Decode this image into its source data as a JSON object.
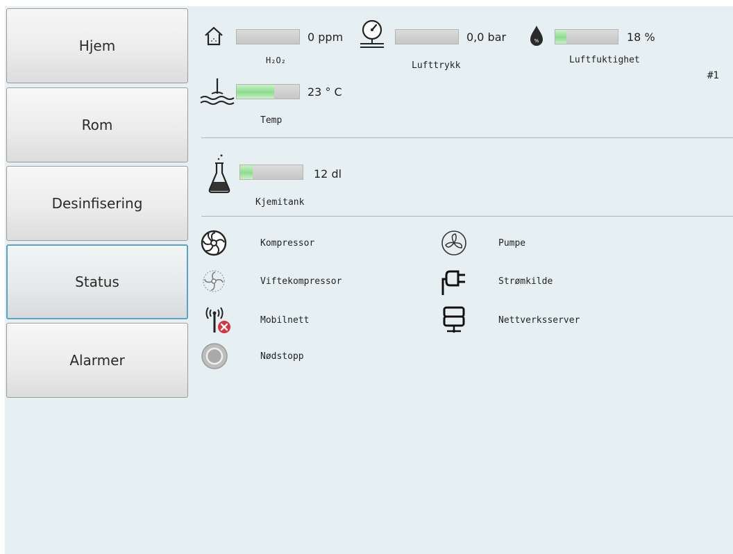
{
  "nav": {
    "items": [
      {
        "label": "Hjem"
      },
      {
        "label": "Rom"
      },
      {
        "label": "Desinfisering"
      },
      {
        "label": "Status"
      },
      {
        "label": "Alarmer"
      }
    ],
    "active": "Status"
  },
  "unit_id": "#1",
  "sensors": {
    "h2o2": {
      "value": "0 ppm",
      "label": "H₂O₂",
      "level": 0,
      "icon": "house-icon"
    },
    "pressure": {
      "value": "0,0 bar",
      "label": "Lufttrykk",
      "level": 0,
      "icon": "pressure-gauge-icon"
    },
    "humidity": {
      "value": "18 %",
      "label": "Luftfuktighet",
      "level": 0.18,
      "icon": "water-drop-icon"
    },
    "temp": {
      "value": "23 ° C",
      "label": "Temp",
      "level": 0.6,
      "icon": "water-temperature-icon"
    },
    "chem_tank": {
      "value": "12 dl",
      "label": "Kjemitank",
      "level": 0.2,
      "icon": "flask-icon"
    }
  },
  "components": {
    "left": [
      {
        "label": "Kompressor",
        "icon": "compressor-fan-icon"
      },
      {
        "label": "Viftekompressor",
        "icon": "fan-compressor-icon"
      },
      {
        "label": "Mobilnett",
        "icon": "antenna-error-icon"
      },
      {
        "label": "Nødstopp",
        "icon": "emergency-stop-icon"
      }
    ],
    "right": [
      {
        "label": "Pumpe",
        "icon": "pump-icon"
      },
      {
        "label": "Strømkilde",
        "icon": "power-plug-icon"
      },
      {
        "label": "Nettverksserver",
        "icon": "network-server-icon"
      }
    ]
  },
  "colors": {
    "background": "#e6f0f2",
    "bar_fill": "#8edc8e",
    "error_red": "#d9333f",
    "active_border": "#5aa0c0"
  }
}
